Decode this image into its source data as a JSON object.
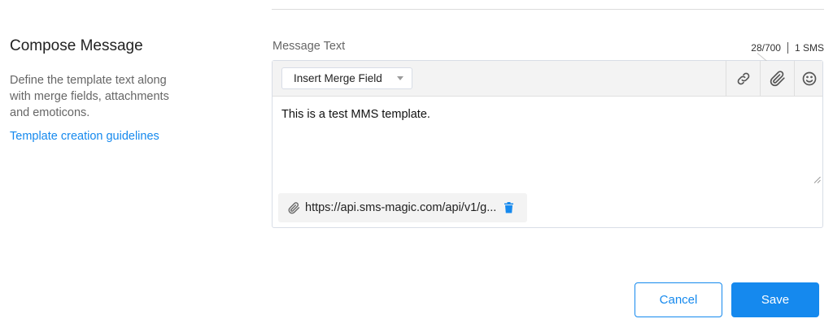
{
  "section": {
    "title": "Compose Message",
    "description": "Define the template text along with merge fields, attachments and emoticons.",
    "guidelines_link": "Template creation guidelines"
  },
  "composer": {
    "label": "Message Text",
    "char_count": "28/700",
    "sms_count": "1 SMS",
    "merge_field_label": "Insert Merge Field",
    "message": "This is a test MMS template.",
    "attachment_url": "https://api.sms-magic.com/api/v1/g...",
    "icons": {
      "link": "link-icon",
      "attach": "paperclip-icon",
      "emoji": "smiley-icon",
      "trash": "trash-icon"
    }
  },
  "actions": {
    "cancel_label": "Cancel",
    "save_label": "Save"
  },
  "colors": {
    "accent": "#1589ee",
    "toolbar_bg": "#f3f3f3",
    "border": "#d8dde6"
  }
}
